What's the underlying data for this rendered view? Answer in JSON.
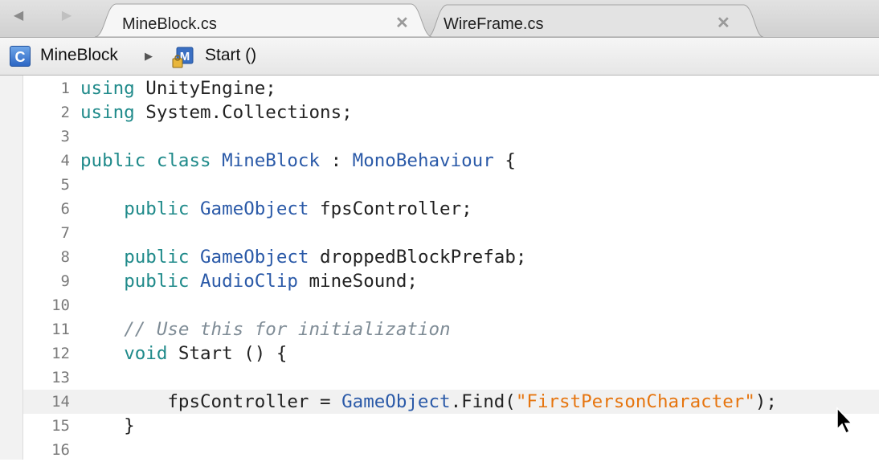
{
  "tabs": [
    {
      "label": "MineBlock.cs",
      "active": true
    },
    {
      "label": "WireFrame.cs",
      "active": false
    }
  ],
  "breadcrumb": {
    "class_name": "MineBlock",
    "method_name": "Start ()",
    "class_icon_letter": "C"
  },
  "editor": {
    "current_line": 14,
    "lines": [
      {
        "n": "1",
        "tokens": [
          {
            "t": "using",
            "c": "kw"
          },
          {
            "t": " UnityEngine;",
            "c": ""
          }
        ]
      },
      {
        "n": "2",
        "tokens": [
          {
            "t": "using",
            "c": "kw"
          },
          {
            "t": " System.Collections;",
            "c": ""
          }
        ]
      },
      {
        "n": "3",
        "tokens": []
      },
      {
        "n": "4",
        "tokens": [
          {
            "t": "public",
            "c": "kw"
          },
          {
            "t": " ",
            "c": ""
          },
          {
            "t": "class",
            "c": "kw"
          },
          {
            "t": " ",
            "c": ""
          },
          {
            "t": "MineBlock",
            "c": "ty"
          },
          {
            "t": " : ",
            "c": ""
          },
          {
            "t": "MonoBehaviour",
            "c": "ty"
          },
          {
            "t": " {",
            "c": ""
          }
        ]
      },
      {
        "n": "5",
        "tokens": []
      },
      {
        "n": "6",
        "tokens": [
          {
            "t": "    ",
            "c": ""
          },
          {
            "t": "public",
            "c": "kw"
          },
          {
            "t": " ",
            "c": ""
          },
          {
            "t": "GameObject",
            "c": "ty"
          },
          {
            "t": " fpsController;",
            "c": ""
          }
        ]
      },
      {
        "n": "7",
        "tokens": []
      },
      {
        "n": "8",
        "tokens": [
          {
            "t": "    ",
            "c": ""
          },
          {
            "t": "public",
            "c": "kw"
          },
          {
            "t": " ",
            "c": ""
          },
          {
            "t": "GameObject",
            "c": "ty"
          },
          {
            "t": " droppedBlockPrefab;",
            "c": ""
          }
        ]
      },
      {
        "n": "9",
        "tokens": [
          {
            "t": "    ",
            "c": ""
          },
          {
            "t": "public",
            "c": "kw"
          },
          {
            "t": " ",
            "c": ""
          },
          {
            "t": "AudioClip",
            "c": "ty"
          },
          {
            "t": " mineSound;",
            "c": ""
          }
        ]
      },
      {
        "n": "10",
        "tokens": []
      },
      {
        "n": "11",
        "tokens": [
          {
            "t": "    ",
            "c": ""
          },
          {
            "t": "// Use this for initialization",
            "c": "cm"
          }
        ]
      },
      {
        "n": "12",
        "tokens": [
          {
            "t": "    ",
            "c": ""
          },
          {
            "t": "void",
            "c": "kw"
          },
          {
            "t": " Start () {",
            "c": ""
          }
        ]
      },
      {
        "n": "13",
        "tokens": []
      },
      {
        "n": "14",
        "tokens": [
          {
            "t": "        fpsController = ",
            "c": ""
          },
          {
            "t": "GameObject",
            "c": "ty"
          },
          {
            "t": ".Find(",
            "c": ""
          },
          {
            "t": "\"FirstPersonCharacter\"",
            "c": "st"
          },
          {
            "t": ");",
            "c": ""
          }
        ]
      },
      {
        "n": "15",
        "tokens": [
          {
            "t": "    }",
            "c": ""
          }
        ]
      },
      {
        "n": "16",
        "tokens": []
      }
    ]
  },
  "colors": {
    "keyword": "#1f8a8a",
    "type": "#2b5aa8",
    "comment": "#7f8c96",
    "string": "#e6750f"
  }
}
